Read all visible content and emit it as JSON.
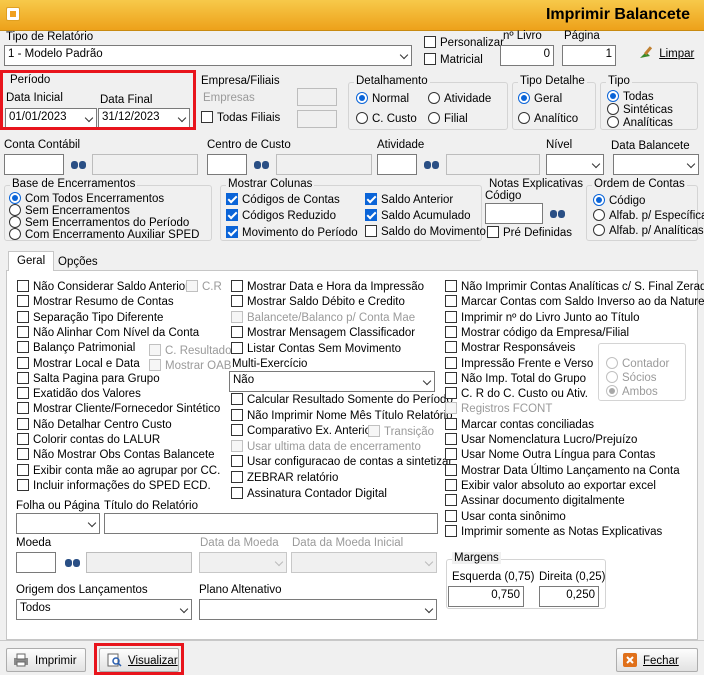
{
  "window": {
    "title": "Imprimir Balancete"
  },
  "top": {
    "tipo_relatorio_label": "Tipo de Relatório",
    "tipo_relatorio_value": "1 - Modelo Padrão",
    "personalizar": "Personalizar",
    "matricial": "Matricial",
    "nlivro_label": "nº Livro",
    "nlivro_value": "0",
    "pagina_label": "Página",
    "pagina_value": "1",
    "limpar": "Limpar"
  },
  "periodo": {
    "title": "Período",
    "inicial_label": "Data Inicial",
    "inicial_value": "01/01/2023",
    "final_label": "Data Final",
    "final_value": "31/12/2023"
  },
  "empresa": {
    "title": "Empresa/Filiais",
    "empresas": "Empresas",
    "todas": "Todas Filiais"
  },
  "detalhamento": {
    "title": "Detalhamento",
    "normal": "Normal",
    "atividade": "Atividade",
    "ccusto": "C. Custo",
    "filial": "Filial"
  },
  "tipo_detalhe": {
    "title": "Tipo Detalhe",
    "geral": "Geral",
    "analitico": "Analítico"
  },
  "tipo": {
    "title": "Tipo",
    "todas": "Todas",
    "sinteticas": "Sintéticas",
    "analiticas": "Analíticas"
  },
  "row2": {
    "conta_contabil": "Conta Contábil",
    "centro_custo": "Centro de Custo",
    "atividade": "Atividade",
    "nivel": "Nível",
    "data_balancete": "Data Balancete"
  },
  "base": {
    "title": "Base de Encerramentos",
    "o1": "Com Todos Encerramentos",
    "o2": "Sem Encerramentos",
    "o3": "Sem Encerramentos do Período",
    "o4": "Com Encerramento Auxiliar SPED"
  },
  "mostrar_colunas": {
    "title": "Mostrar Colunas",
    "c1": "Códigos de Contas",
    "c2": "Códigos Reduzido",
    "c3": "Movimento do Período",
    "c4": "Saldo Anterior",
    "c5": "Saldo Acumulado",
    "c6": "Saldo do Movimento"
  },
  "notas": {
    "title": "Notas Explicativas",
    "codigo": "Código",
    "predef": "Pré Definidas"
  },
  "ordem": {
    "title": "Ordem de Contas",
    "o1": "Código",
    "o2": "Alfab. p/ Específica",
    "o3": "Alfab. p/ Analíticas"
  },
  "tabs": {
    "geral": "Geral",
    "opcoes": "Opções"
  },
  "col1": [
    "Não Considerar Saldo Anterior",
    "Mostrar Resumo de Contas",
    "Separação Tipo Diferente",
    "Não Alinhar Com Nível da Conta",
    "Balanço Patrimonial",
    "Mostrar Local e Data",
    "Salta Pagina para Grupo",
    "Exatidão dos Valores",
    "Mostrar Cliente/Fornecedor Sintético",
    "Não Detalhar Centro Custo",
    "Colorir contas do LALUR",
    "Não Mostrar Obs Contas Balancete",
    "Exibir conta mãe ao agrupar por CC.",
    "Incluir informações do SPED ECD."
  ],
  "col1_extra": {
    "cr": "C.R",
    "cresultado": "C. Resultado",
    "mostrar_oab": "Mostrar OAB"
  },
  "col2": [
    "Mostrar Data e Hora da Impressão",
    "Mostrar Saldo Débito e Credito",
    "Balancete/Balanco p/ Conta Mae",
    "Mostrar Mensagem Classificador",
    "Listar Contas Sem Movimento"
  ],
  "multi": {
    "label": "Multi-Exercício",
    "value": "Não"
  },
  "col2b": [
    "Calcular Resultado Somente do Período",
    "Não Imprimir Nome Mês Título Relatório",
    "Comparativo Ex. Anterior",
    "Usar ultima data de encerramento",
    "Usar configuracao de contas a sintetizar",
    "ZEBRAR relatório",
    "Assinatura Contador Digital"
  ],
  "transicao": "Transição",
  "col3": [
    "Não Imprimir Contas Analíticas c/ S. Final Zerado",
    "Marcar Contas com Saldo Inverso ao da Natureza",
    "Imprimir nº do Livro Junto ao Título",
    "Mostrar código da Empresa/Filial",
    "Mostrar Responsáveis",
    "Impressão Frente e Verso",
    "Não Imp. Total do Grupo",
    "C. R do C. Custo ou Ativ.",
    "Registros FCONT",
    "Marcar contas conciliadas",
    "Usar Nomenclatura Lucro/Prejuízo",
    "Usar Nome Outra Língua para Contas",
    "Mostrar Data Último Lançamento na Conta",
    "Exibir valor absoluto ao exportar excel",
    "Assinar documento digitalmente",
    "Usar conta sinônimo",
    "Imprimir somente as Notas Explicativas"
  ],
  "resp": {
    "contador": "Contador",
    "socios": "Sócios",
    "ambos": "Ambos"
  },
  "bottom": {
    "folha_label": "Folha ou Página",
    "titulo_label": "Título do Relatório",
    "moeda_label": "Moeda",
    "data_moeda": "Data da Moeda",
    "data_moeda_inicial": "Data da Moeda Inicial",
    "origem_label": "Origem dos Lançamentos",
    "origem_value": "Todos",
    "plano_label": "Plano Altenativo"
  },
  "margens": {
    "title": "Margens",
    "esq_label": "Esquerda (0,75)",
    "esq_value": "0,750",
    "dir_label": "Direita (0,25)",
    "dir_value": "0,250"
  },
  "footer": {
    "imprimir": "Imprimir",
    "visualizar": "Visualizar",
    "fechar": "Fechar"
  }
}
